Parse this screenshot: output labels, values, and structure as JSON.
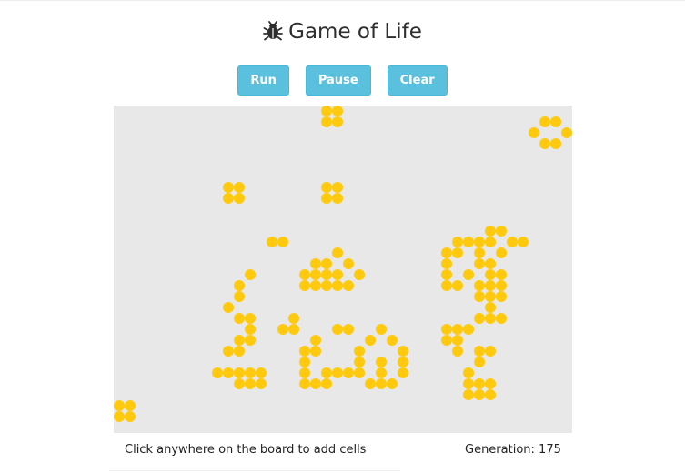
{
  "app": {
    "title": "Game of Life",
    "title_icon": "bug-icon"
  },
  "controls": {
    "run_label": "Run",
    "pause_label": "Pause",
    "clear_label": "Clear"
  },
  "board": {
    "cols": 42,
    "rows": 30,
    "live_color": "#ffc90e",
    "dead_color": "#e8e8e8",
    "live_cells": [
      [
        19,
        0
      ],
      [
        20,
        0
      ],
      [
        19,
        1
      ],
      [
        20,
        1
      ],
      [
        39,
        1
      ],
      [
        40,
        1
      ],
      [
        38,
        2
      ],
      [
        41,
        2
      ],
      [
        39,
        3
      ],
      [
        40,
        3
      ],
      [
        10,
        7
      ],
      [
        11,
        7
      ],
      [
        19,
        7
      ],
      [
        20,
        7
      ],
      [
        10,
        8
      ],
      [
        11,
        8
      ],
      [
        19,
        8
      ],
      [
        20,
        8
      ],
      [
        34,
        11
      ],
      [
        35,
        11
      ],
      [
        14,
        12
      ],
      [
        15,
        12
      ],
      [
        31,
        12
      ],
      [
        32,
        12
      ],
      [
        33,
        12
      ],
      [
        34,
        12
      ],
      [
        36,
        12
      ],
      [
        37,
        12
      ],
      [
        20,
        13
      ],
      [
        30,
        13
      ],
      [
        31,
        13
      ],
      [
        33,
        13
      ],
      [
        35,
        13
      ],
      [
        18,
        14
      ],
      [
        19,
        14
      ],
      [
        21,
        14
      ],
      [
        30,
        14
      ],
      [
        33,
        14
      ],
      [
        34,
        14
      ],
      [
        12,
        15
      ],
      [
        17,
        15
      ],
      [
        18,
        15
      ],
      [
        19,
        15
      ],
      [
        20,
        15
      ],
      [
        22,
        15
      ],
      [
        30,
        15
      ],
      [
        32,
        15
      ],
      [
        34,
        15
      ],
      [
        35,
        15
      ],
      [
        11,
        16
      ],
      [
        17,
        16
      ],
      [
        18,
        16
      ],
      [
        19,
        16
      ],
      [
        20,
        16
      ],
      [
        21,
        16
      ],
      [
        30,
        16
      ],
      [
        31,
        16
      ],
      [
        33,
        16
      ],
      [
        34,
        16
      ],
      [
        35,
        16
      ],
      [
        11,
        17
      ],
      [
        33,
        17
      ],
      [
        34,
        17
      ],
      [
        35,
        17
      ],
      [
        10,
        18
      ],
      [
        34,
        18
      ],
      [
        11,
        19
      ],
      [
        12,
        19
      ],
      [
        16,
        19
      ],
      [
        33,
        19
      ],
      [
        34,
        19
      ],
      [
        35,
        19
      ],
      [
        12,
        20
      ],
      [
        15,
        20
      ],
      [
        16,
        20
      ],
      [
        20,
        20
      ],
      [
        21,
        20
      ],
      [
        24,
        20
      ],
      [
        30,
        20
      ],
      [
        31,
        20
      ],
      [
        32,
        20
      ],
      [
        11,
        21
      ],
      [
        12,
        21
      ],
      [
        18,
        21
      ],
      [
        23,
        21
      ],
      [
        25,
        21
      ],
      [
        30,
        21
      ],
      [
        31,
        21
      ],
      [
        10,
        22
      ],
      [
        11,
        22
      ],
      [
        17,
        22
      ],
      [
        18,
        22
      ],
      [
        22,
        22
      ],
      [
        26,
        22
      ],
      [
        31,
        22
      ],
      [
        33,
        22
      ],
      [
        34,
        22
      ],
      [
        17,
        23
      ],
      [
        22,
        23
      ],
      [
        24,
        23
      ],
      [
        26,
        23
      ],
      [
        33,
        23
      ],
      [
        9,
        24
      ],
      [
        10,
        24
      ],
      [
        11,
        24
      ],
      [
        12,
        24
      ],
      [
        13,
        24
      ],
      [
        17,
        24
      ],
      [
        19,
        24
      ],
      [
        20,
        24
      ],
      [
        21,
        24
      ],
      [
        22,
        24
      ],
      [
        24,
        24
      ],
      [
        26,
        24
      ],
      [
        32,
        24
      ],
      [
        11,
        25
      ],
      [
        12,
        25
      ],
      [
        13,
        25
      ],
      [
        17,
        25
      ],
      [
        18,
        25
      ],
      [
        19,
        25
      ],
      [
        23,
        25
      ],
      [
        24,
        25
      ],
      [
        25,
        25
      ],
      [
        32,
        25
      ],
      [
        33,
        25
      ],
      [
        34,
        25
      ],
      [
        32,
        26
      ],
      [
        33,
        26
      ],
      [
        34,
        26
      ],
      [
        0,
        27
      ],
      [
        1,
        27
      ],
      [
        0,
        28
      ],
      [
        1,
        28
      ]
    ]
  },
  "footer": {
    "hint": "Click anywhere on the board to add cells",
    "generation_label": "Generation:",
    "generation": 175
  }
}
